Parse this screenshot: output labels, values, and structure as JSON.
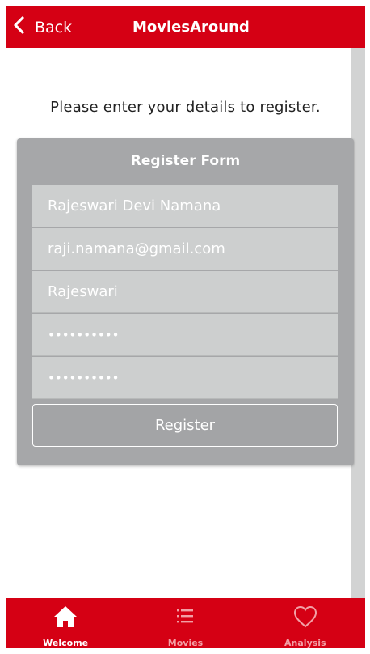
{
  "header": {
    "back_label": "Back",
    "title": "MoviesAround",
    "back_icon": "chevron-left-icon"
  },
  "main": {
    "intro_text": "Please enter your details to register."
  },
  "form": {
    "title": "Register Form",
    "fields": [
      {
        "name": "full-name",
        "value": "Rajeswari Devi Namana"
      },
      {
        "name": "email",
        "value": "raji.namana@gmail.com"
      },
      {
        "name": "username",
        "value": "Rajeswari"
      },
      {
        "name": "password",
        "value": "••••••••••"
      },
      {
        "name": "confirm-password",
        "value": "••••••••••"
      }
    ],
    "submit_label": "Register"
  },
  "tabbar": {
    "tabs": [
      {
        "label": "Welcome",
        "icon": "home-icon",
        "active": true
      },
      {
        "label": "Movies",
        "icon": "list-icon",
        "active": false
      },
      {
        "label": "Analysis",
        "icon": "heart-icon",
        "active": false
      }
    ]
  },
  "colors": {
    "brand": "#d50014",
    "panel": "#a6a7a9",
    "field": "#cdcfcf"
  }
}
